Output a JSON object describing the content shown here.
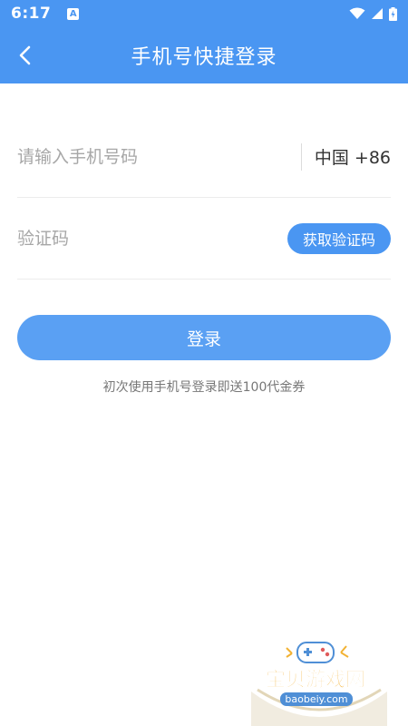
{
  "status_bar": {
    "time": "6:17",
    "notification_icon": "a-notification-icon",
    "wifi_icon": "wifi-icon",
    "signal_icon": "signal-icon",
    "battery_icon": "battery-charging-icon"
  },
  "header": {
    "title": "手机号快捷登录",
    "back_icon": "chevron-left-icon",
    "color": "#4a96f2"
  },
  "form": {
    "phone_placeholder": "请输入手机号码",
    "phone_value": "",
    "country_code": "中国 +86",
    "code_placeholder": "验证码",
    "code_value": "",
    "get_code_label": "获取验证码"
  },
  "login_label": "登录",
  "promo": "初次使用手机号登录即送100代金券",
  "watermark": {
    "name": "宝贝游戏网",
    "url": "baobeiy.com"
  }
}
